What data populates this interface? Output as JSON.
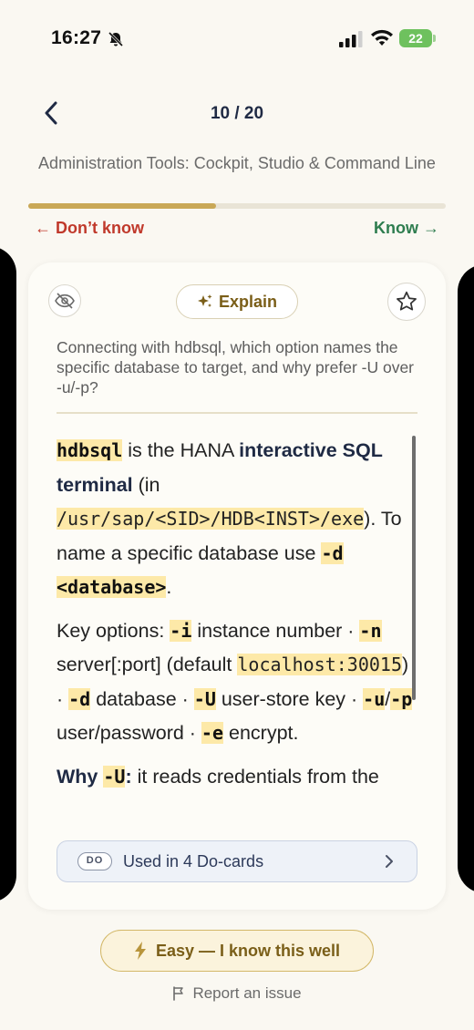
{
  "status": {
    "time": "16:27",
    "battery": "22"
  },
  "header": {
    "counter": "10 / 20",
    "subtitle": "Administration Tools: Cockpit, Studio & Command Line",
    "progress": 0.45
  },
  "swipe": {
    "dont_know": "← Don’t know",
    "know": "Know →"
  },
  "card": {
    "explain_label": "Explain",
    "question": "Connecting with hdbsql, which option names the specific database to target, and why prefer -U over -u/-p?",
    "answer": {
      "p1": {
        "t1": "hdbsql",
        "t2": " is the HANA ",
        "t3": "interactive SQL terminal",
        "t4": " (in ",
        "t5": "/usr/sap/<SID>/HDB<INST>/exe",
        "t6": "). To name a specific database use ",
        "t7": "-d <database>",
        "t8": "."
      },
      "p2": {
        "t1": "Key options: ",
        "t2": "-i",
        "t3": " instance number · ",
        "t4": "-n",
        "t5": " server[:port] (default ",
        "t6": "localhost:30015",
        "t7": ") · ",
        "t8": "-d",
        "t9": " database · ",
        "t10": "-U",
        "t11": " user-store key · ",
        "t12": "-u",
        "t13": "/",
        "t14": "-p",
        "t15": " user/password · ",
        "t16": "-e",
        "t17": " encrypt."
      },
      "p3": {
        "t1": "Why ",
        "t2": "-U",
        "t3": ":",
        "t4": " it reads credentials from the"
      }
    },
    "used_in": {
      "badge": "DO",
      "label": "Used in 4 Do-cards"
    }
  },
  "footer": {
    "easy_label": "Easy — I know this well",
    "report_label": "Report an issue"
  },
  "colors": {
    "accent_gold": "#c9a857",
    "dont_know_red": "#c0392b",
    "know_green": "#2e7d4f",
    "highlight": "#fde9a8"
  }
}
